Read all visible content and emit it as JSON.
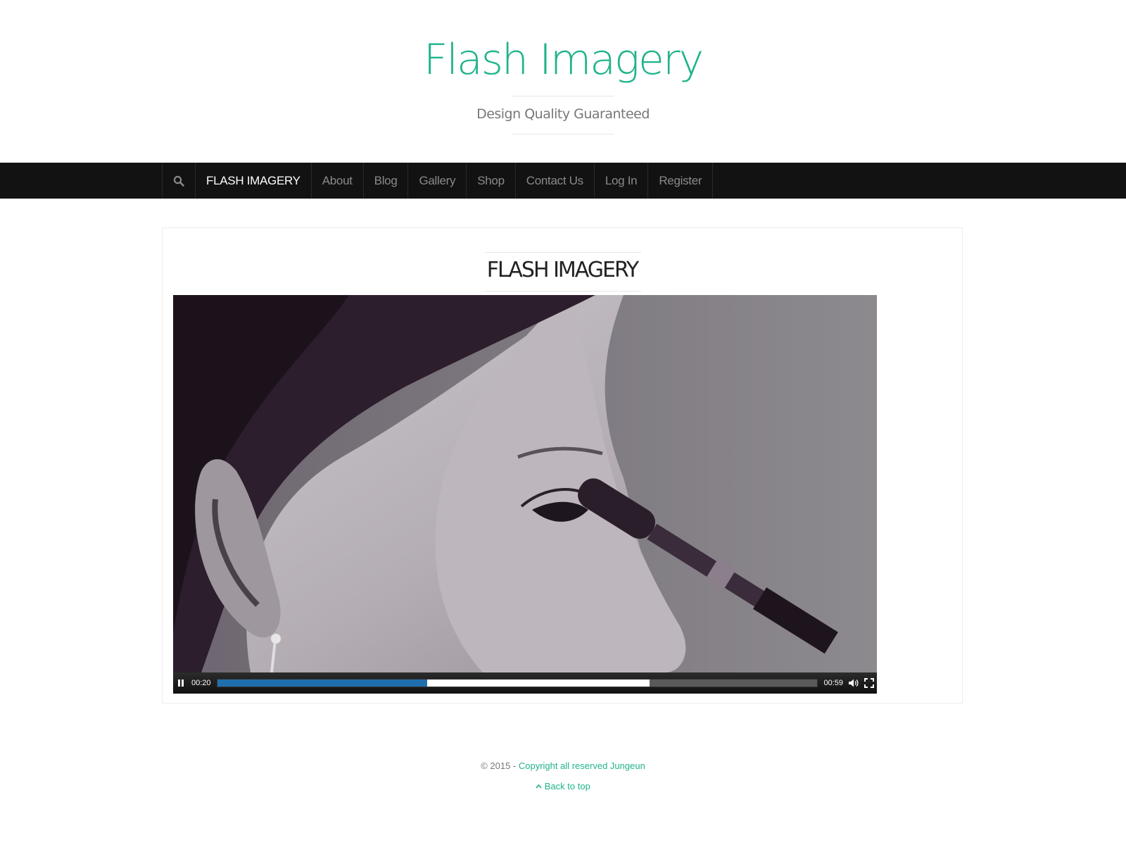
{
  "header": {
    "site_title": "Flash Imagery",
    "tagline": "Design Quality Guaranteed"
  },
  "nav": {
    "search_icon": "search-icon",
    "items": [
      {
        "label": "FLASH IMAGERY",
        "active": true
      },
      {
        "label": "About"
      },
      {
        "label": "Blog"
      },
      {
        "label": "Gallery"
      },
      {
        "label": "Shop"
      },
      {
        "label": "Contact Us"
      },
      {
        "label": "Log In"
      },
      {
        "label": "Register"
      }
    ]
  },
  "entry": {
    "title": "FLASH IMAGERY"
  },
  "video": {
    "current_time": "00:20",
    "duration": "00:59",
    "played_fraction": 0.35,
    "buffered_fraction": 0.72,
    "icons": [
      "pause-icon",
      "volume-icon",
      "fullscreen-icon"
    ]
  },
  "footer": {
    "copyright_prefix": "© 2015 - ",
    "copyright_link": "Copyright all reserved Jungeun",
    "back_to_top": "Back to top"
  },
  "colors": {
    "accent": "#1fb38b",
    "navbar": "#121212",
    "progress": "#1f6fad"
  }
}
